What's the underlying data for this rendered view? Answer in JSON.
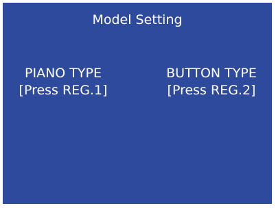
{
  "screen": {
    "title": "Model Setting",
    "background_color": "#2e4a9d",
    "text_color": "#ffffff"
  },
  "options": [
    {
      "label": "PIANO TYPE",
      "hint": "[Press REG.1]"
    },
    {
      "label": "BUTTON TYPE",
      "hint": "[Press REG.2]"
    }
  ]
}
